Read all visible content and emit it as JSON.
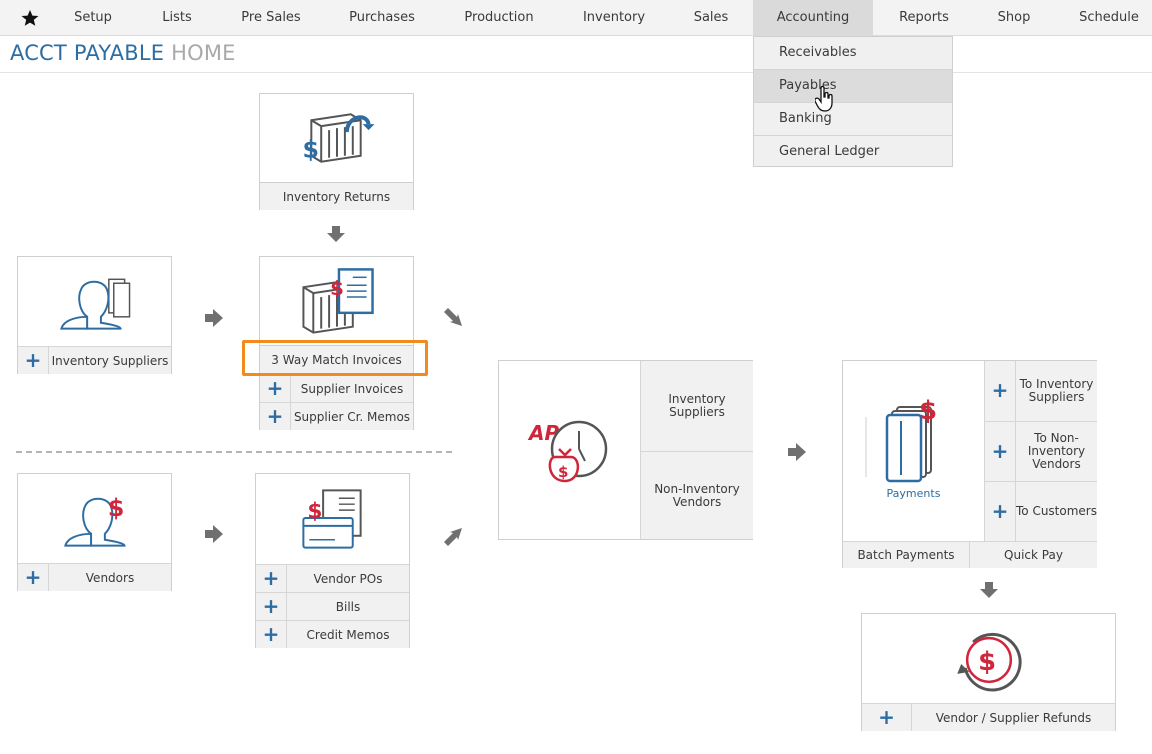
{
  "nav": {
    "items": [
      "Setup",
      "Lists",
      "Pre Sales",
      "Purchases",
      "Production",
      "Inventory",
      "Sales",
      "Accounting",
      "Reports",
      "Shop",
      "Schedule"
    ],
    "active": "Accounting"
  },
  "dropdown": {
    "items": [
      "Receivables",
      "Payables",
      "Banking",
      "General Ledger"
    ],
    "hovered": "Payables"
  },
  "page_title": {
    "primary": "ACCT PAYABLE",
    "secondary": "HOME"
  },
  "cards": {
    "inventory_returns": "Inventory Returns",
    "inventory_suppliers": "Inventory Suppliers",
    "three_way_match": "3 Way Match Invoices",
    "supplier_invoices": "Supplier Invoices",
    "supplier_cr_memos": "Supplier Cr. Memos",
    "vendors": "Vendors",
    "vendor_pos": "Vendor POs",
    "bills": "Bills",
    "credit_memos": "Credit Memos",
    "ap_inventory_suppliers": "Inventory Suppliers",
    "ap_non_inventory_vendors": "Non-Inventory Vendors",
    "ap_badge": "AP",
    "payments": "Payments",
    "to_inventory_suppliers": "To Inventory Suppliers",
    "to_non_inventory_vendors": "To Non-Inventory Vendors",
    "to_customers": "To Customers",
    "batch_payments": "Batch Payments",
    "quick_pay": "Quick Pay",
    "refunds": "Vendor / Supplier Refunds"
  },
  "colors": {
    "accent": "#2d6da3",
    "money": "#d0263b",
    "highlight": "#f28a1e"
  }
}
